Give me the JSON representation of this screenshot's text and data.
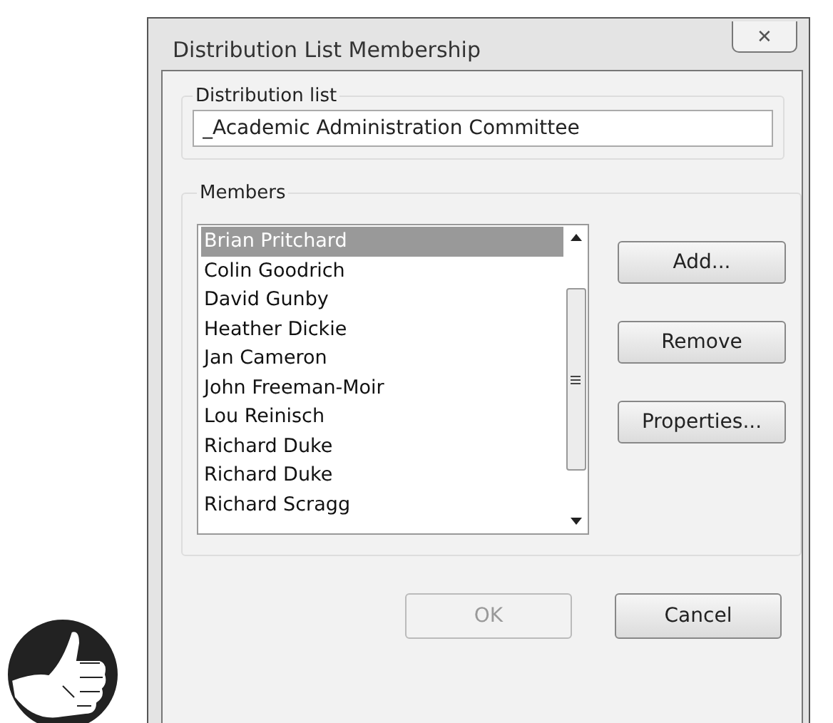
{
  "window": {
    "title": "Distribution List Membership",
    "close": "✕"
  },
  "distribution_list": {
    "label": "Distribution list",
    "value": "_Academic Administration Committee"
  },
  "members": {
    "label": "Members",
    "items": [
      {
        "name": "Brian Pritchard",
        "selected": true
      },
      {
        "name": "Colin Goodrich",
        "selected": false
      },
      {
        "name": "David Gunby",
        "selected": false
      },
      {
        "name": "Heather Dickie",
        "selected": false
      },
      {
        "name": "Jan Cameron",
        "selected": false
      },
      {
        "name": "John Freeman-Moir",
        "selected": false
      },
      {
        "name": "Lou Reinisch",
        "selected": false
      },
      {
        "name": "Richard Duke",
        "selected": false
      },
      {
        "name": "Richard Duke",
        "selected": false
      },
      {
        "name": "Richard Scragg",
        "selected": false
      }
    ]
  },
  "side_buttons": [
    "Add...",
    "Remove",
    "Properties..."
  ],
  "buttons": [
    {
      "label": "OK",
      "disabled": true
    },
    {
      "label": "Cancel",
      "disabled": false
    }
  ]
}
